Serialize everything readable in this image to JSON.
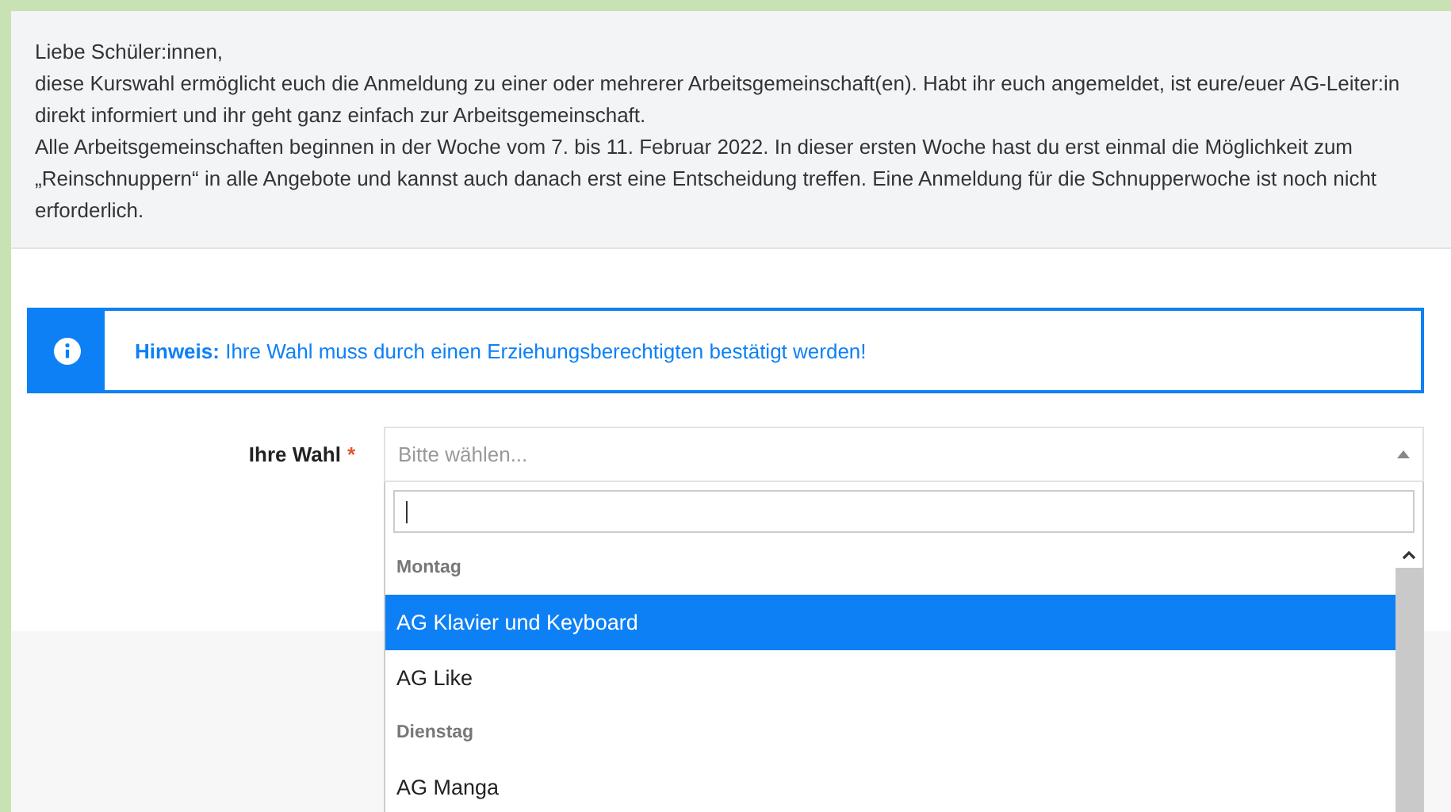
{
  "intro": {
    "greeting": "Liebe Schüler:innen,",
    "paragraphs": [
      "diese Kurswahl ermöglicht euch die Anmeldung zu einer oder mehrerer Arbeitsgemeinschaft(en). Habt ihr euch angemeldet, ist eure/euer AG-Leiter:in direkt informiert und ihr geht ganz einfach zur Arbeitsgemeinschaft.",
      "Alle Arbeitsgemeinschaften beginnen in der Woche vom 7. bis 11. Februar 2022. In dieser ersten Woche hast du erst einmal die Möglichkeit zum „Reinschnuppern“ in alle Angebote und kannst auch danach erst eine Entscheidung treffen. Eine Anmeldung für die Schnupperwoche ist noch nicht erforderlich."
    ]
  },
  "notice": {
    "text": "**Hinweis:** Ihre Wahl muss durch einen Erziehungsberechtigten bestätigt werden!"
  },
  "choice": {
    "label": "Ihre Wahl",
    "required_mark": "*",
    "placeholder": "Bitte wählen...",
    "expanded": true,
    "groups": [
      {
        "label": "Montag",
        "options": [
          {
            "label": "AG Klavier und Keyboard",
            "selected": true
          },
          {
            "label": "AG Like",
            "selected": false
          }
        ]
      },
      {
        "label": "Dienstag",
        "options": [
          {
            "label": "AG Manga",
            "selected": false
          }
        ]
      }
    ]
  }
}
